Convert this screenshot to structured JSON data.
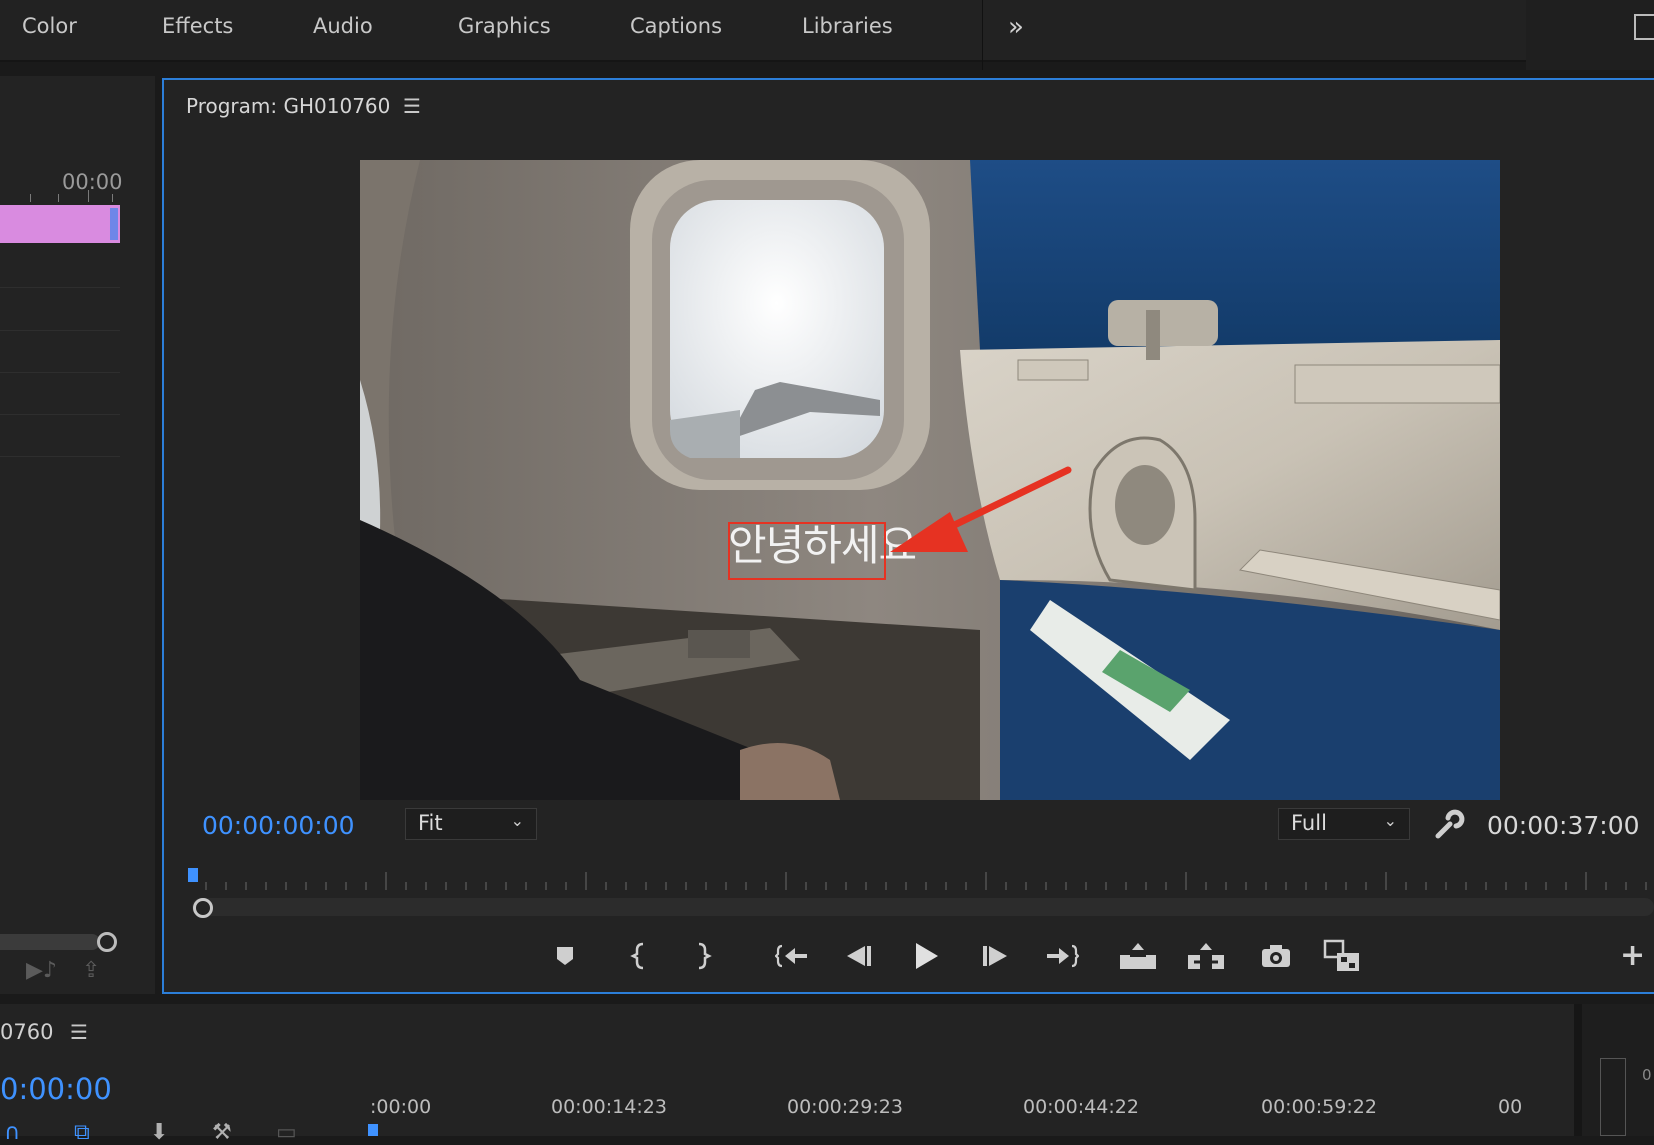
{
  "workspace_tabs": [
    "Color",
    "Effects",
    "Audio",
    "Graphics",
    "Captions",
    "Libraries"
  ],
  "more_label": "»",
  "source_panel": {
    "timecode": "00:00"
  },
  "program": {
    "title": "Program: GH010760",
    "menu_icon": "hamburger-icon",
    "current_timecode": "00:00:00:00",
    "zoom_value": "Fit",
    "resolution_value": "Full",
    "duration_timecode": "00:00:37:00"
  },
  "video": {
    "caption_text": "안녕하세요",
    "annotation_color": "#e63222"
  },
  "transport": {
    "buttons": [
      "add-marker-button",
      "mark-in-button",
      "mark-out-button",
      "go-to-in-button",
      "step-back-button",
      "play-button",
      "step-forward-button",
      "go-to-out-button",
      "lift-button",
      "extract-button",
      "export-frame-button",
      "comparison-view-button"
    ],
    "add_label": "+"
  },
  "timeline": {
    "sequence_name": "0760",
    "timecode": "0:00:00",
    "ruler_times": [
      ":00:00",
      "00:00:14:23",
      "00:00:29:23",
      "00:00:44:22",
      "00:00:59:22",
      "00"
    ],
    "meter_label": "0"
  },
  "colors": {
    "accent_blue": "#3f92ff",
    "panel_border": "#2c7ed8",
    "clip_pink": "#d98be0"
  }
}
